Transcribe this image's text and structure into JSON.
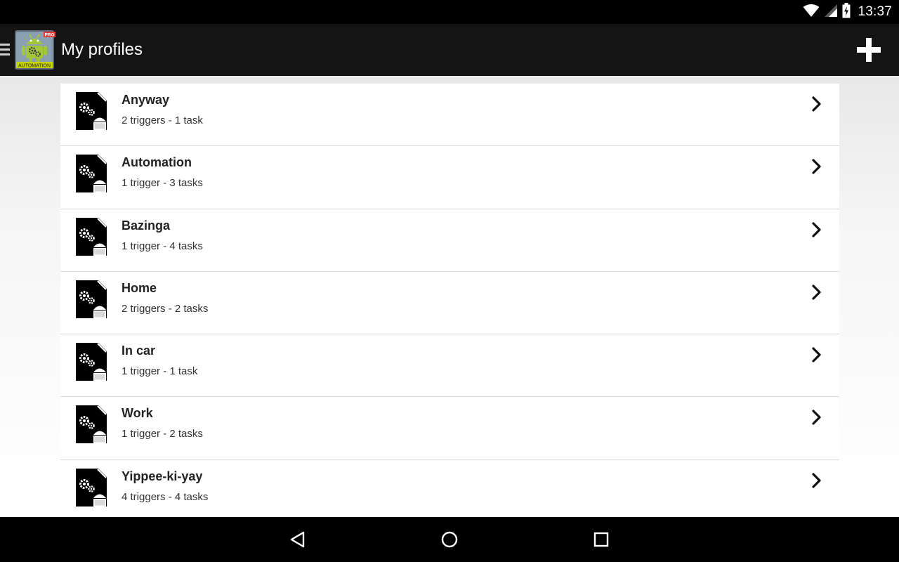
{
  "status_bar": {
    "time": "13:37",
    "icons": [
      "wifi-icon",
      "cell-signal-icon",
      "battery-charging-icon"
    ]
  },
  "action_bar": {
    "app_logo": {
      "icon": "android-gears-logo",
      "text": "AUTOMATION",
      "badge": "PRO"
    },
    "title": "My profiles",
    "add_icon": "plus-icon"
  },
  "profiles": [
    {
      "name": "Anyway",
      "summary": "2 triggers - 1 task"
    },
    {
      "name": "Automation",
      "summary": "1 trigger - 3 tasks"
    },
    {
      "name": "Bazinga",
      "summary": "1 trigger - 4 tasks"
    },
    {
      "name": "Home",
      "summary": "2 triggers - 2 tasks"
    },
    {
      "name": "In car",
      "summary": "1 trigger - 1 task"
    },
    {
      "name": "Work",
      "summary": "1 trigger - 2 tasks"
    },
    {
      "name": "Yippee-ki-yay",
      "summary": "4 triggers - 4 tasks"
    }
  ],
  "nav_bar": {
    "icons": [
      "back-icon",
      "home-icon",
      "recents-icon"
    ]
  },
  "colors": {
    "status_bar": "#000000",
    "action_bar": "#141414",
    "logo_green": "#a4c639",
    "logo_badge": "#e53935"
  }
}
